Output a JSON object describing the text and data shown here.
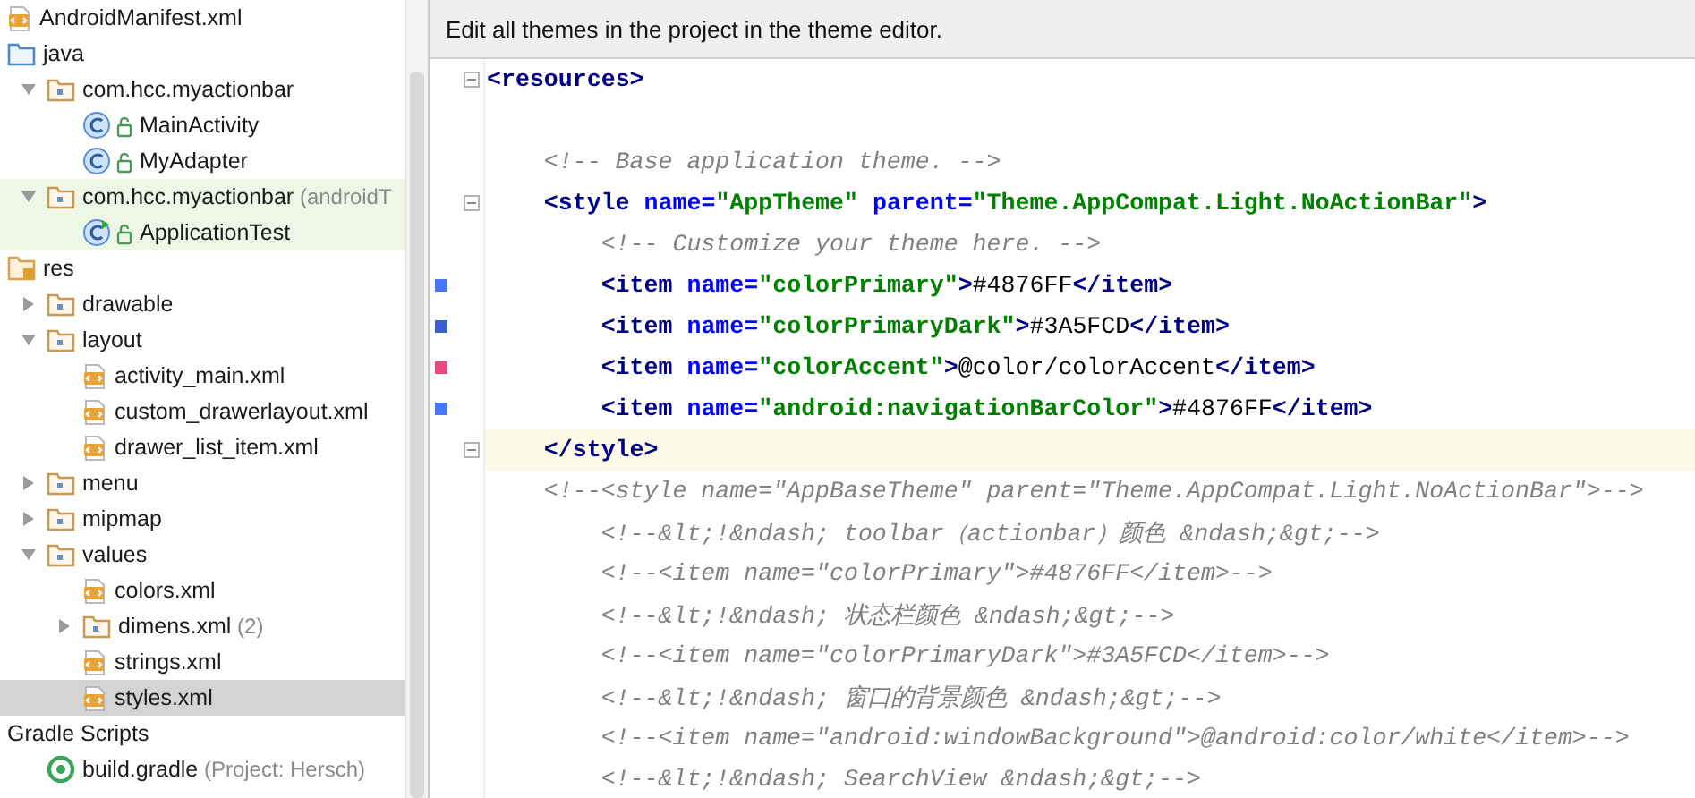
{
  "project_tree": [
    {
      "label": "AndroidManifest.xml",
      "kind": "xml",
      "selected": false
    },
    {
      "label": "java",
      "kind": "java-root",
      "selected": false,
      "children": [
        {
          "label": "com.hcc.myactionbar",
          "kind": "package",
          "expanded": true,
          "selected": false,
          "children": [
            {
              "label": "MainActivity",
              "kind": "class",
              "selected": false
            },
            {
              "label": "MyAdapter",
              "kind": "class",
              "selected": false
            }
          ]
        },
        {
          "label": "com.hcc.myactionbar",
          "note": "(androidT",
          "kind": "test-package",
          "expanded": true,
          "selected": false,
          "children": [
            {
              "label": "ApplicationTest",
              "kind": "test-class",
              "selected": false
            }
          ]
        }
      ]
    },
    {
      "label": "res",
      "kind": "res-root",
      "selected": false,
      "children": [
        {
          "label": "drawable",
          "kind": "folder",
          "expanded": false,
          "selected": false
        },
        {
          "label": "layout",
          "kind": "folder",
          "expanded": true,
          "selected": false,
          "children": [
            {
              "label": "activity_main.xml",
              "kind": "xml",
              "selected": false
            },
            {
              "label": "custom_drawerlayout.xml",
              "kind": "xml",
              "selected": false
            },
            {
              "label": "drawer_list_item.xml",
              "kind": "xml",
              "selected": false
            }
          ]
        },
        {
          "label": "menu",
          "kind": "folder",
          "expanded": false,
          "selected": false
        },
        {
          "label": "mipmap",
          "kind": "folder",
          "expanded": false,
          "selected": false
        },
        {
          "label": "values",
          "kind": "folder",
          "expanded": true,
          "selected": false,
          "children": [
            {
              "label": "colors.xml",
              "kind": "xml",
              "selected": false
            },
            {
              "label": "dimens.xml",
              "note": "(2)",
              "kind": "folder",
              "expanded": false,
              "selected": false
            },
            {
              "label": "strings.xml",
              "kind": "xml",
              "selected": false
            },
            {
              "label": "styles.xml",
              "kind": "xml",
              "selected": true
            }
          ]
        }
      ]
    },
    {
      "label": "Gradle Scripts",
      "kind": "section",
      "selected": false,
      "children": [
        {
          "label": "build.gradle",
          "note": "(Project: Hersch)",
          "kind": "gradle",
          "selected": false
        }
      ]
    }
  ],
  "editor": {
    "banner": "Edit all themes in the project in the theme editor.",
    "lines": [
      {
        "kind": "code",
        "fold": true,
        "segments": [
          {
            "kind": "tag",
            "text": "<resources>"
          }
        ],
        "children": [
          {
            "kind": "blank"
          },
          {
            "kind": "code",
            "segments": [
              {
                "kind": "comment",
                "text": "<!-- Base application theme. -->"
              }
            ]
          },
          {
            "kind": "code",
            "fold": true,
            "segments": [
              {
                "kind": "tag",
                "text": "<style"
              },
              {
                "kind": "attr",
                "text": " name="
              },
              {
                "kind": "value",
                "text": "\"AppTheme\""
              },
              {
                "kind": "attr",
                "text": " parent="
              },
              {
                "kind": "value",
                "text": "\"Theme.AppCompat.Light.NoActionBar\""
              },
              {
                "kind": "tag",
                "text": ">"
              }
            ],
            "children": [
              {
                "kind": "code",
                "segments": [
                  {
                    "kind": "comment",
                    "text": "<!-- Customize your theme here. -->"
                  }
                ]
              },
              {
                "kind": "code",
                "color": "#4876ff",
                "segments": [
                  {
                    "kind": "tag",
                    "text": "<item"
                  },
                  {
                    "kind": "attr",
                    "text": " name="
                  },
                  {
                    "kind": "value",
                    "text": "\"colorPrimary\""
                  },
                  {
                    "kind": "tag",
                    "text": ">"
                  },
                  {
                    "kind": "text",
                    "text": "#4876FF"
                  },
                  {
                    "kind": "tag",
                    "text": "</item>"
                  }
                ]
              },
              {
                "kind": "code",
                "color": "#3a5fcd",
                "segments": [
                  {
                    "kind": "tag",
                    "text": "<item"
                  },
                  {
                    "kind": "attr",
                    "text": " name="
                  },
                  {
                    "kind": "value",
                    "text": "\"colorPrimaryDark\""
                  },
                  {
                    "kind": "tag",
                    "text": ">"
                  },
                  {
                    "kind": "text",
                    "text": "#3A5FCD"
                  },
                  {
                    "kind": "tag",
                    "text": "</item>"
                  }
                ]
              },
              {
                "kind": "code",
                "color": "#e84c7d",
                "segments": [
                  {
                    "kind": "tag",
                    "text": "<item"
                  },
                  {
                    "kind": "attr",
                    "text": " name="
                  },
                  {
                    "kind": "value",
                    "text": "\"colorAccent\""
                  },
                  {
                    "kind": "tag",
                    "text": ">"
                  },
                  {
                    "kind": "text",
                    "text": "@color/colorAccent"
                  },
                  {
                    "kind": "tag",
                    "text": "</item>"
                  }
                ]
              },
              {
                "kind": "code",
                "color": "#4876ff",
                "segments": [
                  {
                    "kind": "tag",
                    "text": "<item"
                  },
                  {
                    "kind": "attr",
                    "text": " name="
                  },
                  {
                    "kind": "value",
                    "text": "\"android:navigationBarColor\""
                  },
                  {
                    "kind": "tag",
                    "text": ">"
                  },
                  {
                    "kind": "text",
                    "text": "#4876FF"
                  },
                  {
                    "kind": "tag",
                    "text": "</item>"
                  }
                ]
              }
            ]
          },
          {
            "kind": "code",
            "fold": true,
            "current": true,
            "segments": [
              {
                "kind": "tag",
                "text": "</style>"
              }
            ]
          },
          {
            "kind": "code",
            "segments": [
              {
                "kind": "comment",
                "text": "<!--<style name=\"AppBaseTheme\" parent=\"Theme.AppCompat.Light.NoActionBar\">-->"
              }
            ],
            "children": [
              {
                "kind": "code",
                "segments": [
                  {
                    "kind": "comment",
                    "text": "<!--&lt;!&ndash; toolbar（actionbar）颜色 &ndash;&gt;-->"
                  }
                ]
              },
              {
                "kind": "code",
                "segments": [
                  {
                    "kind": "comment",
                    "text": "<!--<item name=\"colorPrimary\">#4876FF</item>-->"
                  }
                ]
              },
              {
                "kind": "code",
                "segments": [
                  {
                    "kind": "comment",
                    "text": "<!--&lt;!&ndash; 状态栏颜色 &ndash;&gt;-->"
                  }
                ]
              },
              {
                "kind": "code",
                "segments": [
                  {
                    "kind": "comment",
                    "text": "<!--<item name=\"colorPrimaryDark\">#3A5FCD</item>-->"
                  }
                ]
              },
              {
                "kind": "code",
                "segments": [
                  {
                    "kind": "comment",
                    "text": "<!--&lt;!&ndash; 窗口的背景颜色 &ndash;&gt;-->"
                  }
                ]
              },
              {
                "kind": "code",
                "segments": [
                  {
                    "kind": "comment",
                    "text": "<!--<item name=\"android:windowBackground\">@android:color/white</item>-->"
                  }
                ]
              },
              {
                "kind": "code",
                "segments": [
                  {
                    "kind": "comment",
                    "text": "<!--&lt;!&ndash; SearchView &ndash;&gt;-->"
                  }
                ]
              }
            ]
          }
        ]
      }
    ]
  }
}
